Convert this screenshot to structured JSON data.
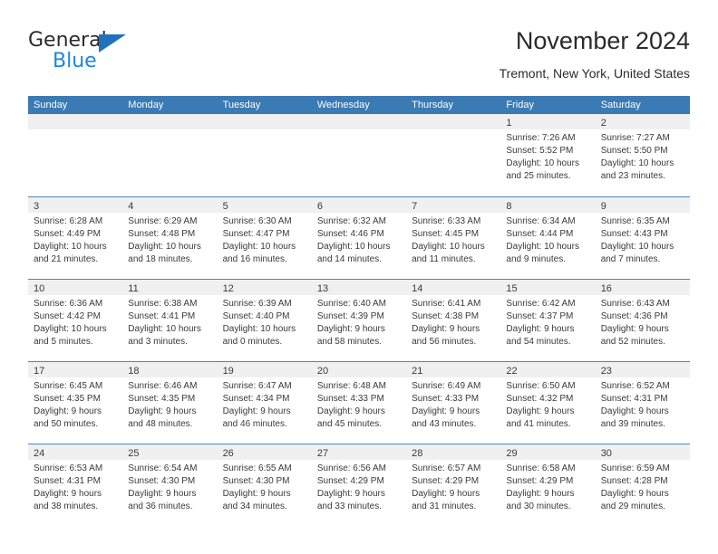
{
  "brand": {
    "word1": "General",
    "word2": "Blue",
    "triangle_color": "#1f72bd",
    "word2_color": "#1f87d8"
  },
  "header": {
    "title": "November 2024",
    "subtitle": "Tremont, New York, United States"
  },
  "theme": {
    "header_blue": "#3a7ab5",
    "row_rule_blue": "#4a86bd",
    "date_band_gray": "#f0f0f0",
    "text_color": "#3a3a3a"
  },
  "weekdays": [
    "Sunday",
    "Monday",
    "Tuesday",
    "Wednesday",
    "Thursday",
    "Friday",
    "Saturday"
  ],
  "weeks": [
    [
      {
        "day": "",
        "lines": [
          "",
          "",
          "",
          ""
        ]
      },
      {
        "day": "",
        "lines": [
          "",
          "",
          "",
          ""
        ]
      },
      {
        "day": "",
        "lines": [
          "",
          "",
          "",
          ""
        ]
      },
      {
        "day": "",
        "lines": [
          "",
          "",
          "",
          ""
        ]
      },
      {
        "day": "",
        "lines": [
          "",
          "",
          "",
          ""
        ]
      },
      {
        "day": "1",
        "lines": [
          "Sunrise: 7:26 AM",
          "Sunset: 5:52 PM",
          "Daylight: 10 hours",
          "and 25 minutes."
        ]
      },
      {
        "day": "2",
        "lines": [
          "Sunrise: 7:27 AM",
          "Sunset: 5:50 PM",
          "Daylight: 10 hours",
          "and 23 minutes."
        ]
      }
    ],
    [
      {
        "day": "3",
        "lines": [
          "Sunrise: 6:28 AM",
          "Sunset: 4:49 PM",
          "Daylight: 10 hours",
          "and 21 minutes."
        ]
      },
      {
        "day": "4",
        "lines": [
          "Sunrise: 6:29 AM",
          "Sunset: 4:48 PM",
          "Daylight: 10 hours",
          "and 18 minutes."
        ]
      },
      {
        "day": "5",
        "lines": [
          "Sunrise: 6:30 AM",
          "Sunset: 4:47 PM",
          "Daylight: 10 hours",
          "and 16 minutes."
        ]
      },
      {
        "day": "6",
        "lines": [
          "Sunrise: 6:32 AM",
          "Sunset: 4:46 PM",
          "Daylight: 10 hours",
          "and 14 minutes."
        ]
      },
      {
        "day": "7",
        "lines": [
          "Sunrise: 6:33 AM",
          "Sunset: 4:45 PM",
          "Daylight: 10 hours",
          "and 11 minutes."
        ]
      },
      {
        "day": "8",
        "lines": [
          "Sunrise: 6:34 AM",
          "Sunset: 4:44 PM",
          "Daylight: 10 hours",
          "and 9 minutes."
        ]
      },
      {
        "day": "9",
        "lines": [
          "Sunrise: 6:35 AM",
          "Sunset: 4:43 PM",
          "Daylight: 10 hours",
          "and 7 minutes."
        ]
      }
    ],
    [
      {
        "day": "10",
        "lines": [
          "Sunrise: 6:36 AM",
          "Sunset: 4:42 PM",
          "Daylight: 10 hours",
          "and 5 minutes."
        ]
      },
      {
        "day": "11",
        "lines": [
          "Sunrise: 6:38 AM",
          "Sunset: 4:41 PM",
          "Daylight: 10 hours",
          "and 3 minutes."
        ]
      },
      {
        "day": "12",
        "lines": [
          "Sunrise: 6:39 AM",
          "Sunset: 4:40 PM",
          "Daylight: 10 hours",
          "and 0 minutes."
        ]
      },
      {
        "day": "13",
        "lines": [
          "Sunrise: 6:40 AM",
          "Sunset: 4:39 PM",
          "Daylight: 9 hours",
          "and 58 minutes."
        ]
      },
      {
        "day": "14",
        "lines": [
          "Sunrise: 6:41 AM",
          "Sunset: 4:38 PM",
          "Daylight: 9 hours",
          "and 56 minutes."
        ]
      },
      {
        "day": "15",
        "lines": [
          "Sunrise: 6:42 AM",
          "Sunset: 4:37 PM",
          "Daylight: 9 hours",
          "and 54 minutes."
        ]
      },
      {
        "day": "16",
        "lines": [
          "Sunrise: 6:43 AM",
          "Sunset: 4:36 PM",
          "Daylight: 9 hours",
          "and 52 minutes."
        ]
      }
    ],
    [
      {
        "day": "17",
        "lines": [
          "Sunrise: 6:45 AM",
          "Sunset: 4:35 PM",
          "Daylight: 9 hours",
          "and 50 minutes."
        ]
      },
      {
        "day": "18",
        "lines": [
          "Sunrise: 6:46 AM",
          "Sunset: 4:35 PM",
          "Daylight: 9 hours",
          "and 48 minutes."
        ]
      },
      {
        "day": "19",
        "lines": [
          "Sunrise: 6:47 AM",
          "Sunset: 4:34 PM",
          "Daylight: 9 hours",
          "and 46 minutes."
        ]
      },
      {
        "day": "20",
        "lines": [
          "Sunrise: 6:48 AM",
          "Sunset: 4:33 PM",
          "Daylight: 9 hours",
          "and 45 minutes."
        ]
      },
      {
        "day": "21",
        "lines": [
          "Sunrise: 6:49 AM",
          "Sunset: 4:33 PM",
          "Daylight: 9 hours",
          "and 43 minutes."
        ]
      },
      {
        "day": "22",
        "lines": [
          "Sunrise: 6:50 AM",
          "Sunset: 4:32 PM",
          "Daylight: 9 hours",
          "and 41 minutes."
        ]
      },
      {
        "day": "23",
        "lines": [
          "Sunrise: 6:52 AM",
          "Sunset: 4:31 PM",
          "Daylight: 9 hours",
          "and 39 minutes."
        ]
      }
    ],
    [
      {
        "day": "24",
        "lines": [
          "Sunrise: 6:53 AM",
          "Sunset: 4:31 PM",
          "Daylight: 9 hours",
          "and 38 minutes."
        ]
      },
      {
        "day": "25",
        "lines": [
          "Sunrise: 6:54 AM",
          "Sunset: 4:30 PM",
          "Daylight: 9 hours",
          "and 36 minutes."
        ]
      },
      {
        "day": "26",
        "lines": [
          "Sunrise: 6:55 AM",
          "Sunset: 4:30 PM",
          "Daylight: 9 hours",
          "and 34 minutes."
        ]
      },
      {
        "day": "27",
        "lines": [
          "Sunrise: 6:56 AM",
          "Sunset: 4:29 PM",
          "Daylight: 9 hours",
          "and 33 minutes."
        ]
      },
      {
        "day": "28",
        "lines": [
          "Sunrise: 6:57 AM",
          "Sunset: 4:29 PM",
          "Daylight: 9 hours",
          "and 31 minutes."
        ]
      },
      {
        "day": "29",
        "lines": [
          "Sunrise: 6:58 AM",
          "Sunset: 4:29 PM",
          "Daylight: 9 hours",
          "and 30 minutes."
        ]
      },
      {
        "day": "30",
        "lines": [
          "Sunrise: 6:59 AM",
          "Sunset: 4:28 PM",
          "Daylight: 9 hours",
          "and 29 minutes."
        ]
      }
    ]
  ]
}
